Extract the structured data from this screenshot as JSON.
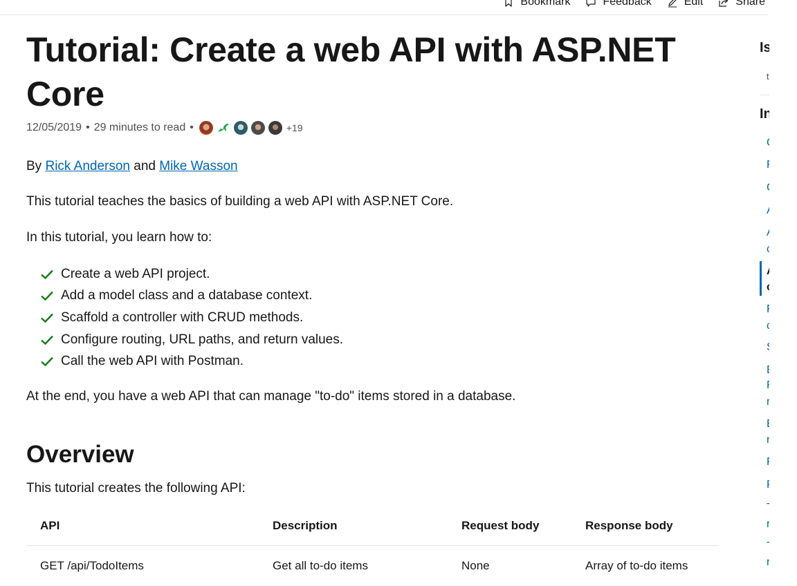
{
  "actions": {
    "bookmark": "Bookmark",
    "feedback": "Feedback",
    "edit": "Edit",
    "share": "Share"
  },
  "article": {
    "title": "Tutorial: Create a web API with ASP.NET Core",
    "date": "12/05/2019",
    "bullet": "•",
    "read_time": "29 minutes to read",
    "contributors_more": "+19",
    "byline": {
      "prefix": "By",
      "author1": "Rick Anderson",
      "joiner": "and",
      "author2": "Mike Wasson"
    },
    "intro": "This tutorial teaches the basics of building a web API with ASP.NET Core.",
    "learn_lead": "In this tutorial, you learn how to:",
    "checklist": [
      "Create a web API project.",
      "Add a model class and a database context.",
      "Scaffold a controller with CRUD methods.",
      "Configure routing, URL paths, and return values.",
      "Call the web API with Postman."
    ],
    "outro": "At the end, you have a web API that can manage \"to-do\" items stored in a database.",
    "overview_heading": "Overview",
    "api_lead": "This tutorial creates the following API:",
    "table": {
      "headers": [
        "API",
        "Description",
        "Request body",
        "Response body"
      ],
      "rows": [
        [
          "GET /api/TodoItems",
          "Get all to-do items",
          "None",
          "Array of to-do items"
        ]
      ]
    }
  },
  "right_rail": {
    "heading1": "Is",
    "heading2": "In",
    "small_text": "t",
    "toc_items": [
      "C",
      "F",
      "C",
      "A",
      "A",
      "c",
      "A",
      "c",
      "F",
      "c",
      "S",
      "E",
      "F",
      "r",
      "E",
      "r",
      "F",
      "F",
      "T",
      "r",
      "T",
      "r"
    ]
  },
  "colors": {
    "link": "#0065b3",
    "check": "#107c10",
    "text": "#171717",
    "muted": "#505050"
  }
}
